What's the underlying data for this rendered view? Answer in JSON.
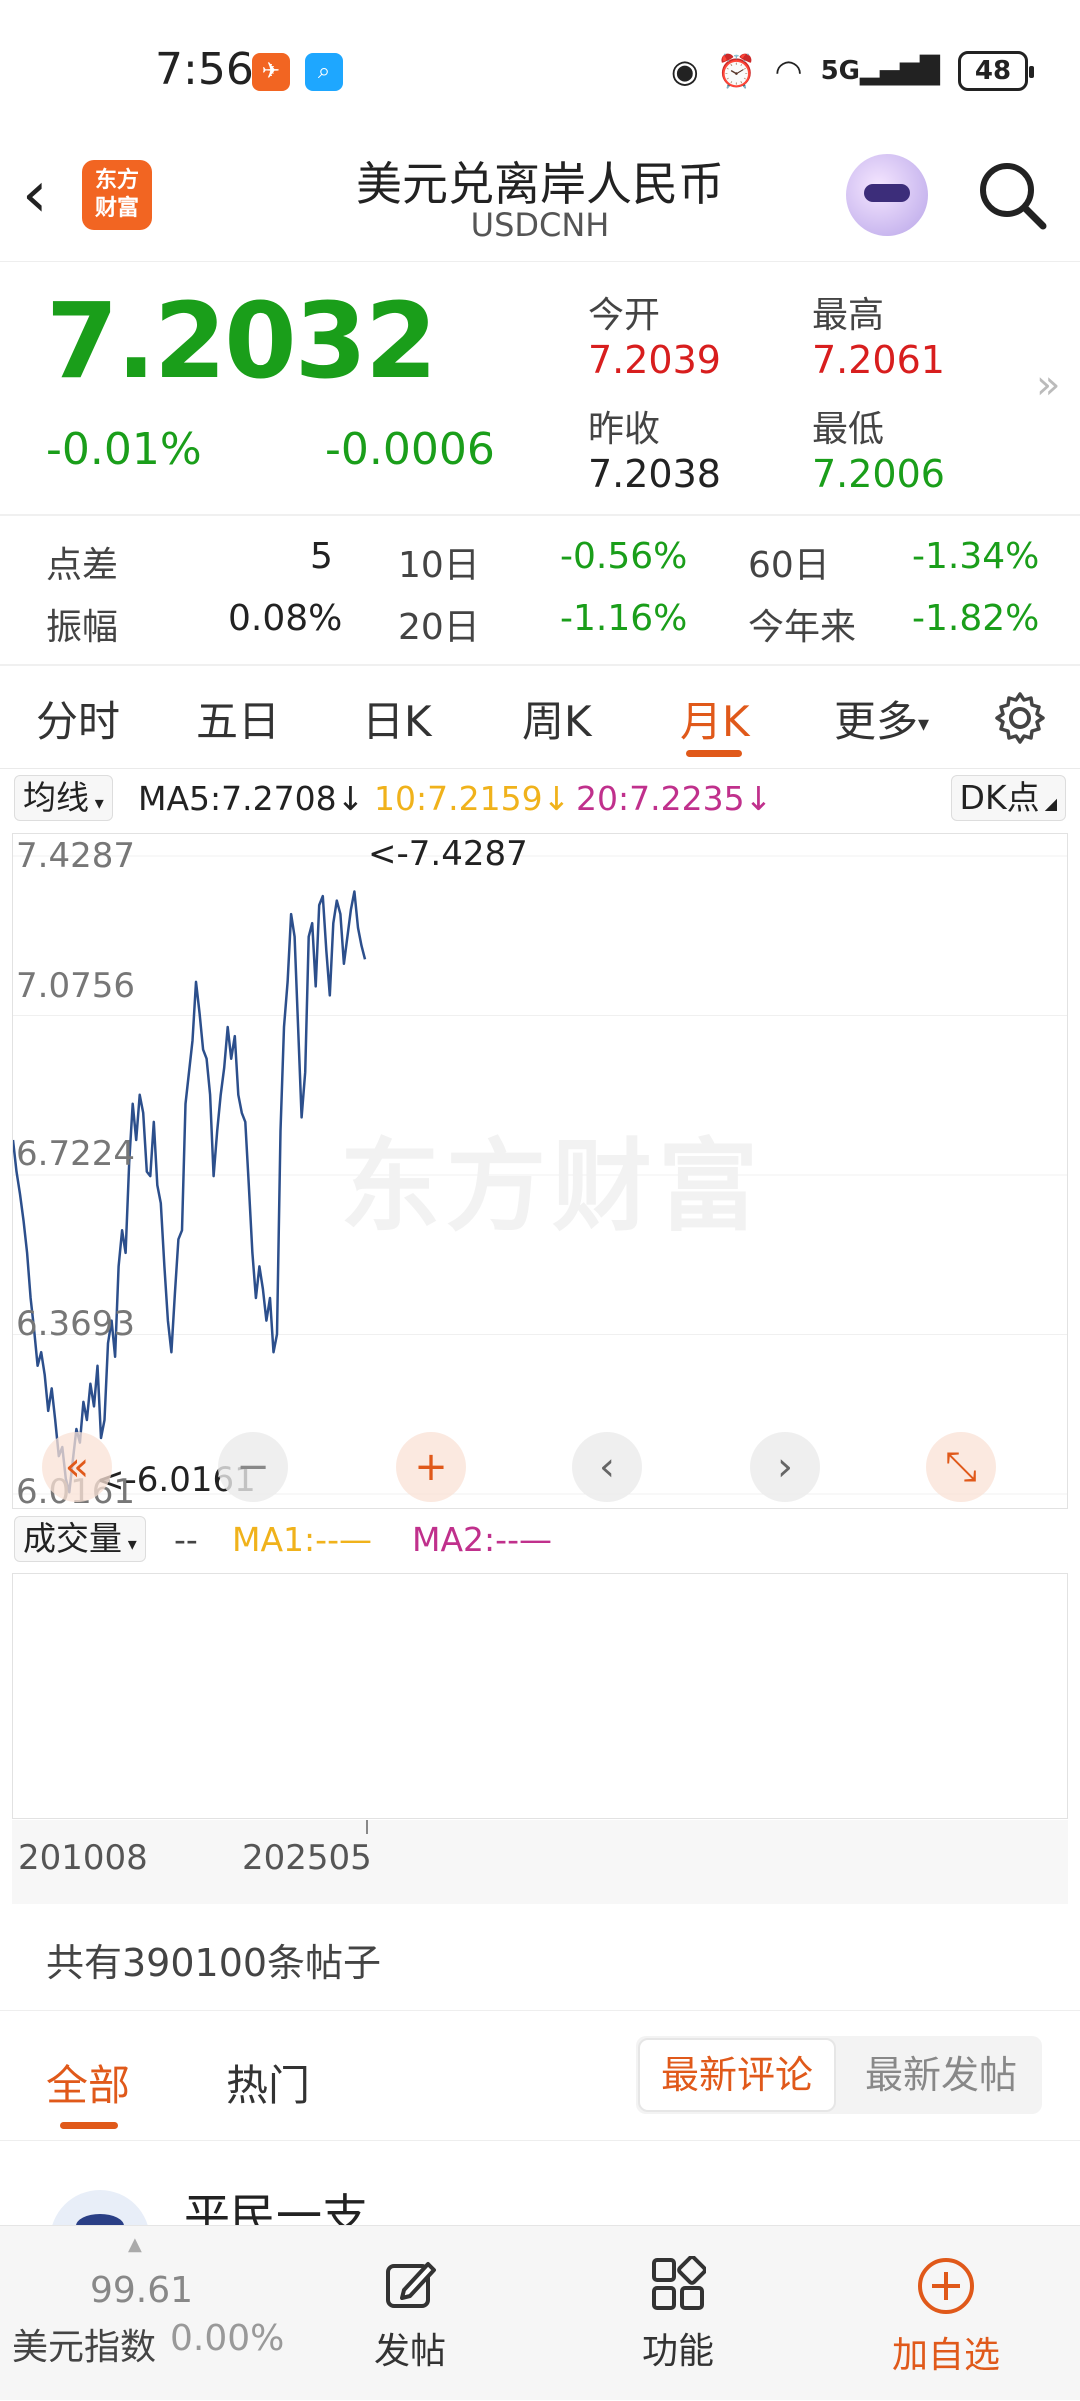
{
  "status_bar": {
    "time": "7:56",
    "network": "5G",
    "battery": "48"
  },
  "header": {
    "back": "‹",
    "logo_text_1": "东方",
    "logo_text_2": "财富",
    "title": "美元兑离岸人民币",
    "subtitle": "USDCNH"
  },
  "quote": {
    "price": "7.2032",
    "change_pct": "-0.01%",
    "change": "-0.0006",
    "open_label": "今开",
    "open": "7.2039",
    "high_label": "最高",
    "high": "7.2061",
    "prev_close_label": "昨收",
    "prev_close": "7.2038",
    "low_label": "最低",
    "low": "7.2006",
    "more": "»"
  },
  "stats": {
    "spread_label": "点差",
    "spread": "5",
    "d10_label": "10日",
    "d10": "-0.56%",
    "d60_label": "60日",
    "d60": "-1.34%",
    "amp_label": "振幅",
    "amp": "0.08%",
    "d20_label": "20日",
    "d20": "-1.16%",
    "ytd_label": "今年来",
    "ytd": "-1.82%"
  },
  "tabs": [
    "分时",
    "五日",
    "日K",
    "周K",
    "月K",
    "更多"
  ],
  "tab_more_arrow": "▾",
  "ma": {
    "dropdown": "均线",
    "ma5": "MA5:7.2708↓",
    "ma10": "10:7.2159↓",
    "ma20": "20:7.2235↓",
    "dk": "DK点"
  },
  "chart_data": {
    "type": "line",
    "title": "",
    "y_ticks": [
      "7.4287",
      "7.0756",
      "6.7224",
      "6.3693",
      "6.0161"
    ],
    "ylim": [
      6.0161,
      7.4287
    ],
    "max_label": "<-7.4287",
    "min_label": "<-6.0161",
    "x_ticks": [
      "201008",
      "202505"
    ],
    "color": "#2c4f8c",
    "series": [
      {
        "values": [
          6.8,
          6.73,
          6.68,
          6.62,
          6.55,
          6.45,
          6.38,
          6.3,
          6.33,
          6.28,
          6.2,
          6.25,
          6.18,
          6.1,
          6.12,
          6.05,
          6.02,
          6.09,
          6.16,
          6.13,
          6.22,
          6.18,
          6.26,
          6.21,
          6.3,
          6.14,
          6.18,
          6.35,
          6.4,
          6.32,
          6.52,
          6.6,
          6.55,
          6.75,
          6.88,
          6.8,
          6.9,
          6.86,
          6.73,
          6.72,
          6.84,
          6.7,
          6.66,
          6.52,
          6.4,
          6.33,
          6.46,
          6.58,
          6.6,
          6.88,
          6.95,
          7.02,
          7.15,
          7.08,
          7.0,
          6.98,
          6.9,
          6.72,
          6.82,
          6.9,
          6.96,
          7.05,
          6.98,
          7.03,
          6.9,
          6.86,
          6.84,
          6.7,
          6.55,
          6.45,
          6.52,
          6.47,
          6.4,
          6.45,
          6.33,
          6.37,
          6.82,
          7.05,
          7.15,
          7.3,
          7.25,
          7.05,
          6.85,
          6.95,
          7.25,
          7.28,
          7.14,
          7.32,
          7.34,
          7.22,
          7.12,
          7.28,
          7.33,
          7.3,
          7.19,
          7.25,
          7.31,
          7.35,
          7.27,
          7.23,
          7.2
        ]
      }
    ]
  },
  "chart_controls": {
    "rewind": "«",
    "minus": "−",
    "plus": "+",
    "left": "‹",
    "right": "›",
    "expand": "⤡"
  },
  "watermark": "东方财富",
  "volume": {
    "dropdown": "成交量",
    "dash": "--",
    "ma1": "MA1:--—",
    "ma2": "MA2:--—"
  },
  "posts": {
    "count_text": "共有390100条帖子",
    "tab_all": "全部",
    "tab_hot": "热门",
    "sort_latest_comment": "最新评论",
    "sort_latest_post": "最新发帖",
    "first_user": "平民一支"
  },
  "bottom_bar": {
    "index_value": "99.61",
    "index_name": "美元指数",
    "index_change": "0.00%",
    "post": "发帖",
    "functions": "功能",
    "add_watch": "加自选"
  },
  "colors": {
    "up": "#d81e1e",
    "down": "#1a9e1a",
    "accent": "#e0591a",
    "ma10": "#f0b21b",
    "ma20": "#c0308c",
    "line": "#2c4f8c"
  }
}
